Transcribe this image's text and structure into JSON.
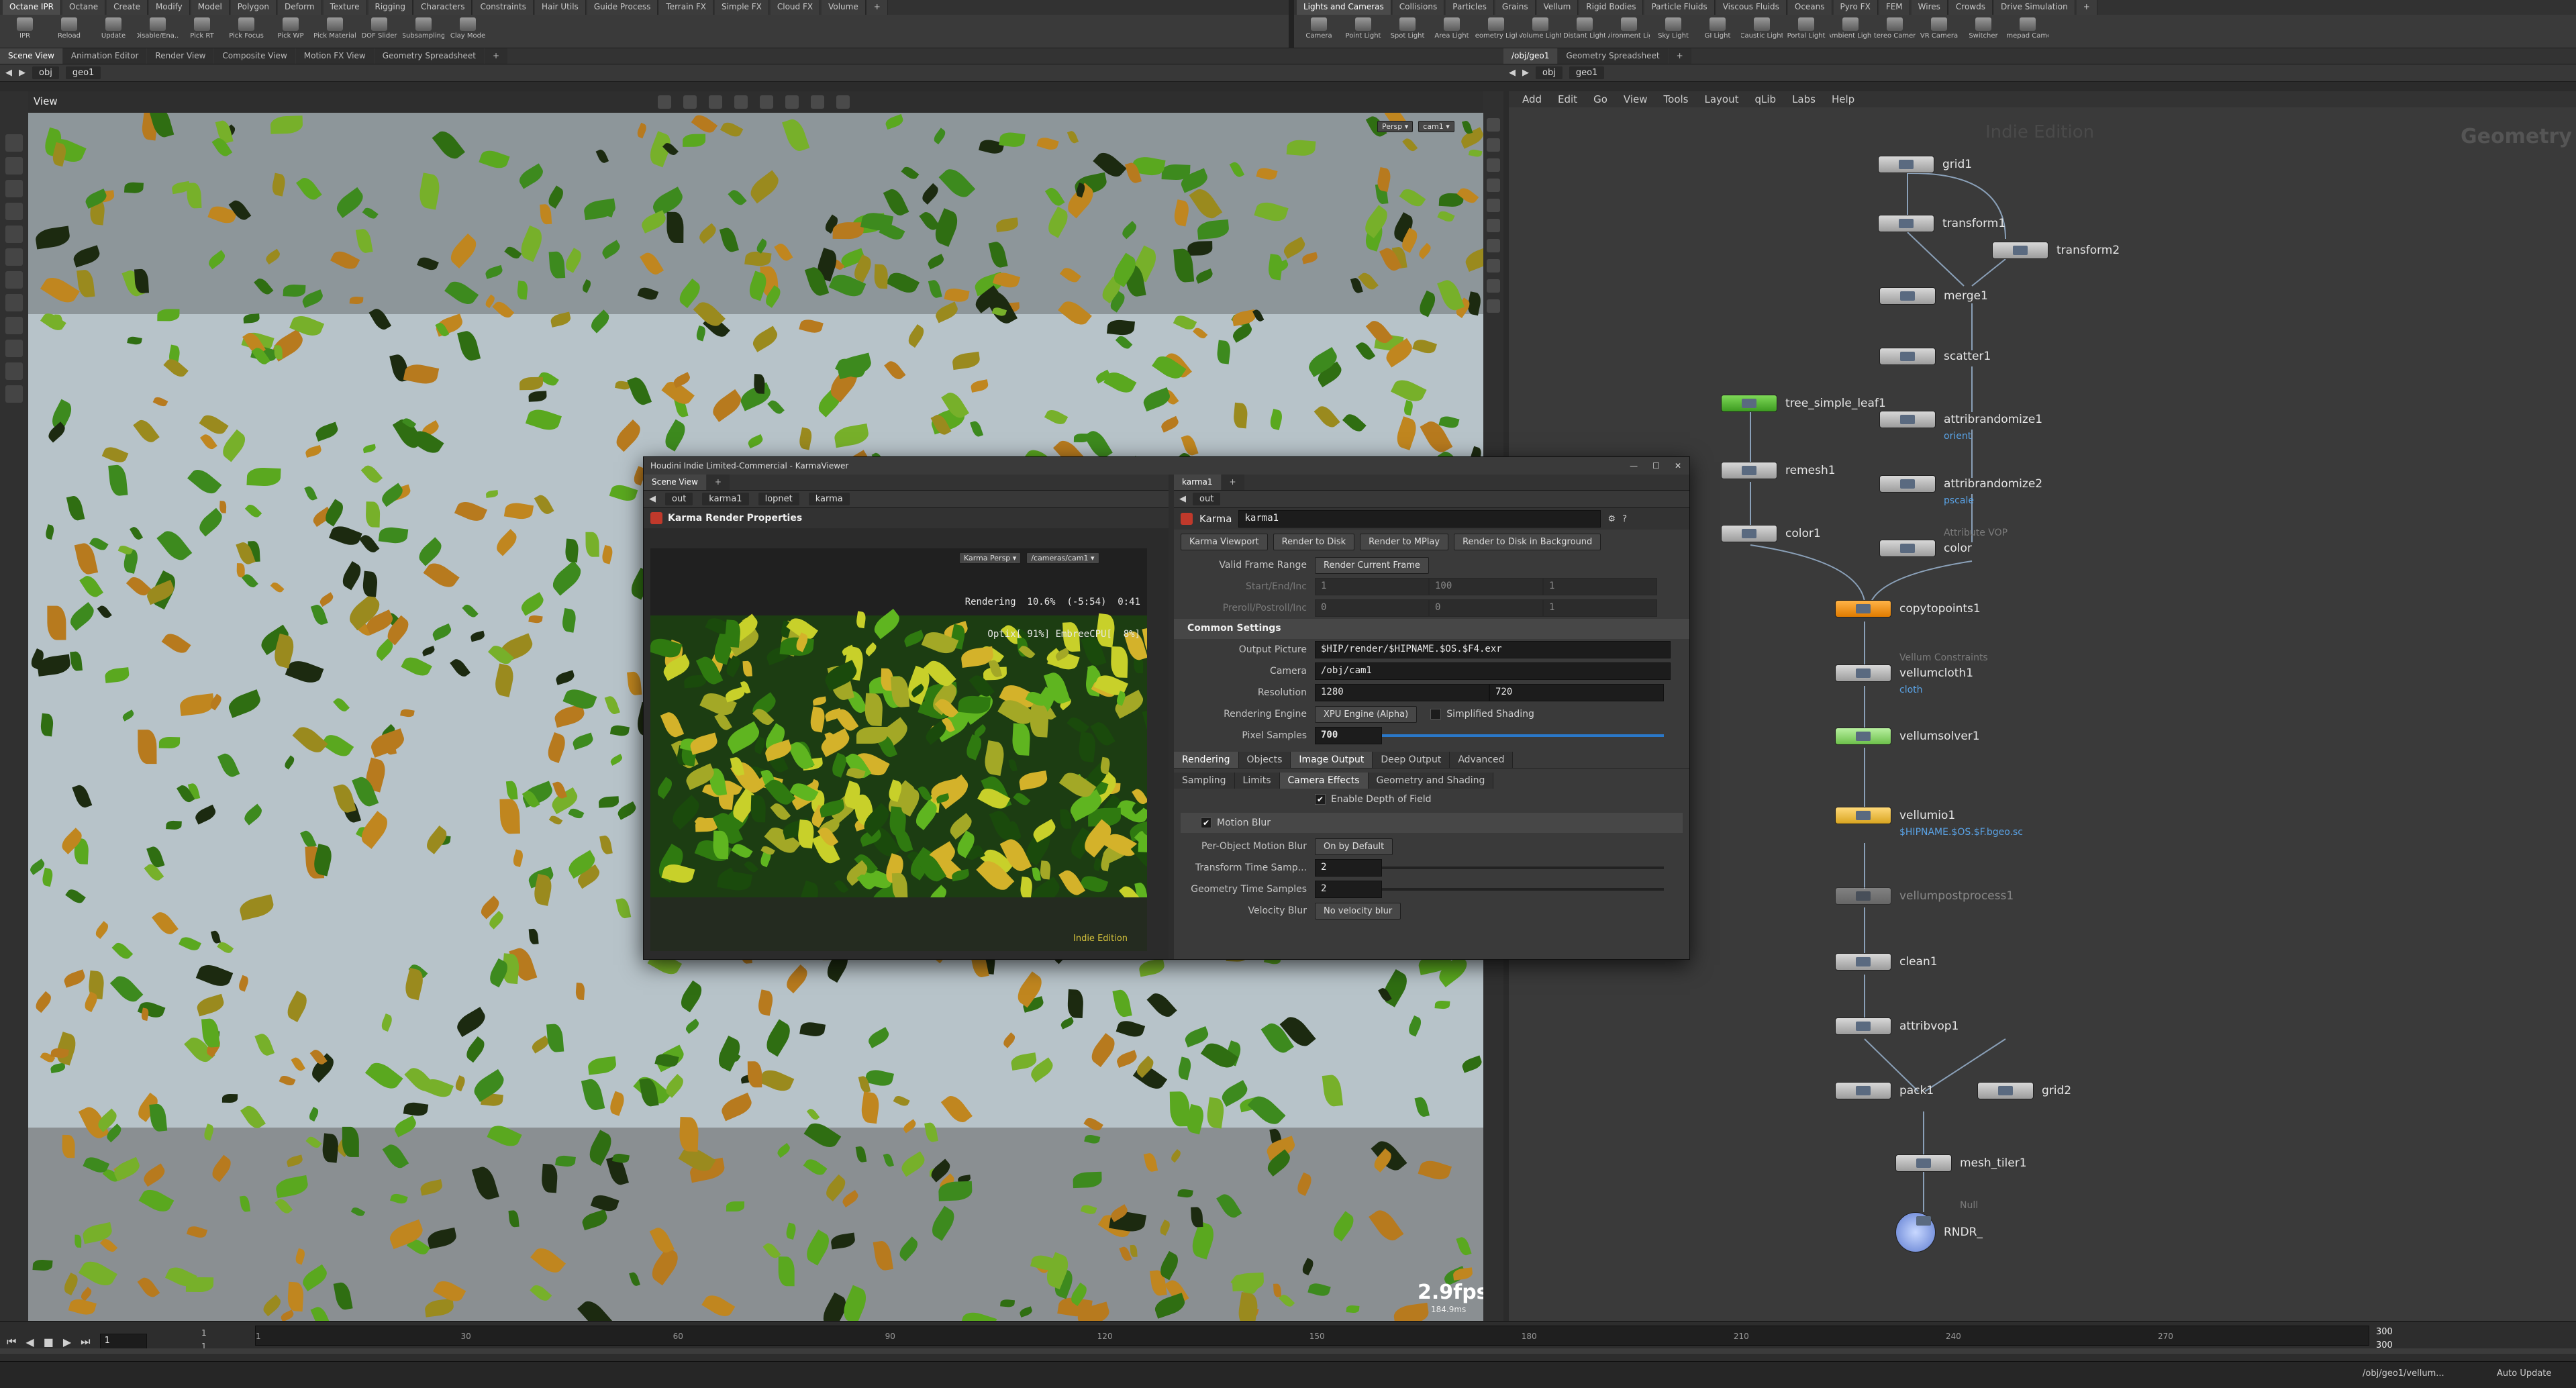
{
  "shelf_left": {
    "tabs": [
      "Octane IPR",
      "Octane",
      "Create",
      "Modify",
      "Model",
      "Polygon",
      "Deform",
      "Texture",
      "Rigging",
      "Characters",
      "Constraints",
      "Hair Utils",
      "Guide Process",
      "Terrain FX",
      "Simple FX",
      "Cloud FX",
      "Volume",
      "+"
    ],
    "tools": [
      "IPR",
      "Reload",
      "Update",
      "Disable/Ena...",
      "Pick RT",
      "Pick Focus",
      "Pick WP",
      "Pick Material",
      "DOF Slider",
      "Subsampling",
      "Clay Mode"
    ]
  },
  "shelf_right": {
    "tabs": [
      "Lights and Cameras",
      "Collisions",
      "Particles",
      "Grains",
      "Vellum",
      "Rigid Bodies",
      "Particle Fluids",
      "Viscous Fluids",
      "Oceans",
      "Pyro FX",
      "FEM",
      "Wires",
      "Crowds",
      "Drive Simulation",
      "+"
    ],
    "tools": [
      "Camera",
      "Point Light",
      "Spot Light",
      "Area Light",
      "Geometry Light",
      "Volume Light",
      "Distant Light",
      "Environment Light",
      "Sky Light",
      "GI Light",
      "Caustic Light",
      "Portal Light",
      "Ambient Light",
      "Stereo Camera",
      "VR Camera",
      "Switcher",
      "Gamepad Camera"
    ]
  },
  "left_pane": {
    "tabs": [
      "Scene View",
      "Animation Editor",
      "Render View",
      "Composite View",
      "Motion FX View",
      "Geometry Spreadsheet",
      "+"
    ],
    "path": [
      "obj",
      "geo1"
    ],
    "view_label": "View",
    "persp": "Persp ▾",
    "cam": "cam1 ▾",
    "fps": "2.9fps",
    "fps_sub": "184.9ms"
  },
  "right_pane": {
    "tabs": [
      "/obj/geo1",
      "Geometry Spreadsheet",
      "+"
    ],
    "path": [
      "obj",
      "geo1"
    ],
    "menu": [
      "Add",
      "Edit",
      "Go",
      "View",
      "Tools",
      "Layout",
      "qLib",
      "Labs",
      "Help"
    ],
    "watermark": "Indie Edition",
    "context_label": "Geometry"
  },
  "nodes": [
    {
      "name": "grid1"
    },
    {
      "name": "transform1"
    },
    {
      "name": "transform2"
    },
    {
      "name": "merge1"
    },
    {
      "name": "scatter1"
    },
    {
      "name": "attribrandomize1",
      "sub": "orient"
    },
    {
      "name": "attribrandomize2",
      "sub": "pscale"
    },
    {
      "name": "color",
      "pre": "Attribute VOP"
    },
    {
      "name": "tree_simple_leaf1"
    },
    {
      "name": "remesh1"
    },
    {
      "name": "color1"
    },
    {
      "name": "copytopoints1"
    },
    {
      "name": "vellumcloth1",
      "pre": "Vellum Constraints",
      "sub": "cloth"
    },
    {
      "name": "vellumsolver1"
    },
    {
      "name": "vellumio1",
      "sub": "$HIPNAME.$OS.$F.bgeo.sc"
    },
    {
      "name": "vellumpostprocess1"
    },
    {
      "name": "clean1"
    },
    {
      "name": "attribvop1"
    },
    {
      "name": "pack1"
    },
    {
      "name": "grid2"
    },
    {
      "name": "mesh_tiler1"
    },
    {
      "name": "RNDR_",
      "pre": "Null"
    }
  ],
  "karma_window": {
    "title": "Houdini Indie Limited-Commercial - KarmaViewer",
    "left_tabs": [
      "Scene View",
      "+"
    ],
    "left_path": [
      "out",
      "karma1",
      "lopnet",
      "karma"
    ],
    "panel_title": "Karma Render Properties",
    "persp": "Karma Persp ▾",
    "cam": "/cameras/cam1 ▾",
    "render_stats_1": "Rendering  10.6%  (-5:54)  0:41",
    "render_stats_2": "Optix[ 91%] EmbreeCPU[  8%]",
    "indie": "Indie Edition",
    "right_tabs": [
      "karma1",
      "+"
    ],
    "right_path": "out",
    "node_type": "Karma",
    "node_name": "karma1",
    "buttons": [
      "Karma Viewport",
      "Render to Disk",
      "Render to MPlay",
      "Render to Disk in Background"
    ],
    "valid_frame_label": "Valid Frame Range",
    "valid_frame_value": "Render Current Frame",
    "start_label": "Start/End/Inc",
    "start_values": [
      "1",
      "100",
      "1"
    ],
    "preroll_label": "Preroll/Postroll/Inc",
    "preroll_values": [
      "0",
      "0",
      "1"
    ],
    "common": "Common Settings",
    "output_label": "Output Picture",
    "output_value": "$HIP/render/$HIPNAME.$OS.$F4.exr",
    "camera_label": "Camera",
    "camera_value": "/obj/cam1",
    "res_label": "Resolution",
    "res_x": "1280",
    "res_y": "720",
    "engine_label": "Rendering Engine",
    "engine_value": "XPU Engine (Alpha)",
    "simplified": "Simplified Shading",
    "samples_label": "Pixel Samples",
    "samples_value": "700",
    "tabs_1": [
      "Rendering",
      "Objects",
      "Image Output",
      "Deep Output",
      "Advanced"
    ],
    "tabs_2": [
      "Sampling",
      "Limits",
      "Camera Effects",
      "Geometry and Shading"
    ],
    "dof": "Enable Depth of Field",
    "motion_blur": "Motion Blur",
    "pomb_label": "Per-Object Motion Blur",
    "pomb_value": "On by Default",
    "tts_label": "Transform Time Samp...",
    "tts_value": "2",
    "gts_label": "Geometry Time Samples",
    "gts_value": "2",
    "vb_label": "Velocity Blur",
    "vb_value": "No velocity blur"
  },
  "timeline": {
    "ticks": [
      "1",
      "30",
      "60",
      "90",
      "120",
      "150",
      "180",
      "210",
      "240",
      "270"
    ],
    "current": "1",
    "start": "1",
    "end": "1",
    "range_end_1": "300",
    "range_end_2": "300"
  },
  "status": {
    "path": "/obj/geo1/vellum...",
    "auto_update": "Auto Update"
  }
}
